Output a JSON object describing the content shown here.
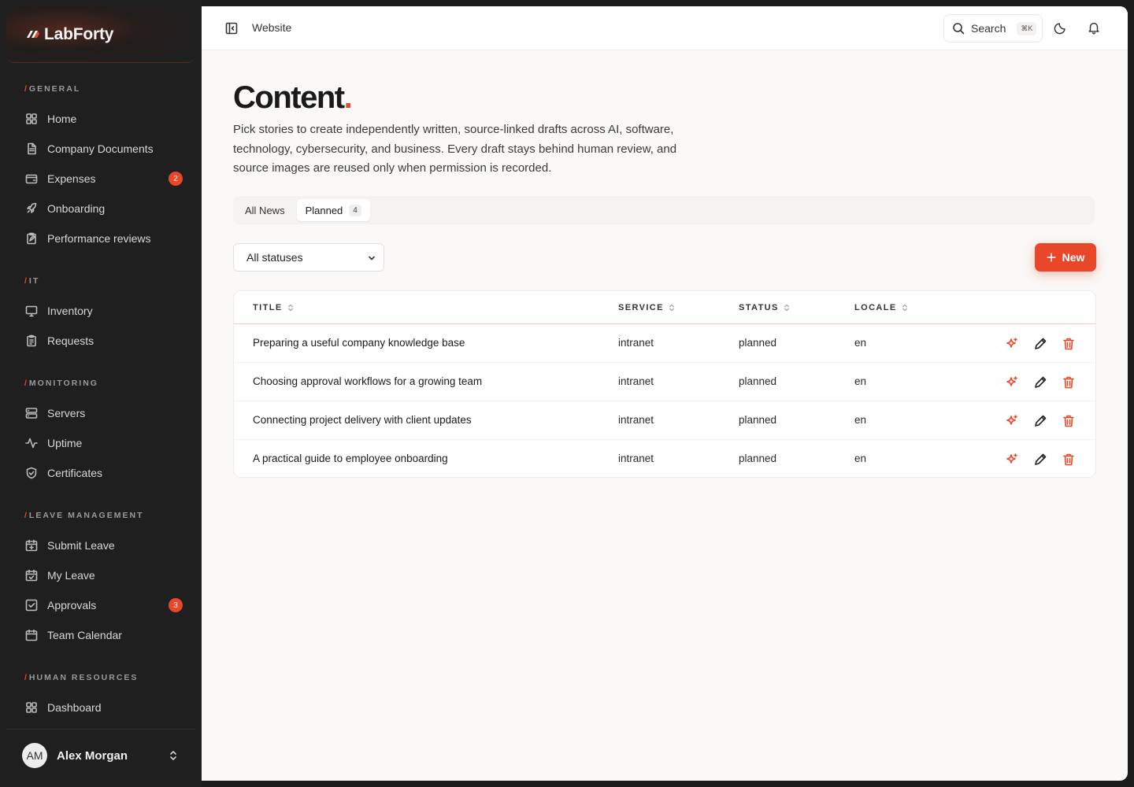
{
  "brand": {
    "name": "LabForty"
  },
  "sidebar": {
    "sections": [
      {
        "label": "GENERAL"
      },
      {
        "label": "IT"
      },
      {
        "label": "MONITORING"
      },
      {
        "label": "LEAVE MANAGEMENT"
      },
      {
        "label": "HUMAN RESOURCES"
      }
    ],
    "items": [
      {
        "label": "Home",
        "icon": "grid-icon"
      },
      {
        "label": "Company Documents",
        "icon": "document-icon"
      },
      {
        "label": "Expenses",
        "icon": "wallet-icon",
        "badge": "2"
      },
      {
        "label": "Onboarding",
        "icon": "rocket-icon"
      },
      {
        "label": "Performance reviews",
        "icon": "clipboard-edit-icon"
      },
      {
        "label": "Inventory",
        "icon": "monitor-icon"
      },
      {
        "label": "Requests",
        "icon": "clipboard-list-icon"
      },
      {
        "label": "Servers",
        "icon": "server-icon"
      },
      {
        "label": "Uptime",
        "icon": "activity-icon"
      },
      {
        "label": "Certificates",
        "icon": "shield-check-icon"
      },
      {
        "label": "Submit Leave",
        "icon": "calendar-plus-icon"
      },
      {
        "label": "My Leave",
        "icon": "calendar-check-icon"
      },
      {
        "label": "Approvals",
        "icon": "check-square-icon",
        "badge": "3"
      },
      {
        "label": "Team Calendar",
        "icon": "calendar-icon"
      },
      {
        "label": "Dashboard",
        "icon": "grid-icon"
      }
    ],
    "user": {
      "initials": "AM",
      "name": "Alex Morgan"
    }
  },
  "topbar": {
    "breadcrumb": "Website",
    "search_label": "Search",
    "search_shortcut": "⌘K"
  },
  "page": {
    "title": "Content",
    "title_dot": ".",
    "description": "Pick stories to create independently written, source-linked drafts across AI, software, technology, cybersecurity, and business. Every draft stays behind human review, and source images are reused only when permission is recorded."
  },
  "tabs": [
    {
      "label": "All News"
    },
    {
      "label": "Planned",
      "count": "4"
    }
  ],
  "filter": {
    "selected": "All statuses"
  },
  "new_button": {
    "label": "New"
  },
  "table": {
    "columns": [
      "TITLE",
      "SERVICE",
      "STATUS",
      "LOCALE"
    ],
    "rows": [
      {
        "title": "Preparing a useful company knowledge base",
        "service": "intranet",
        "status": "planned",
        "locale": "en"
      },
      {
        "title": "Choosing approval workflows for a growing team",
        "service": "intranet",
        "status": "planned",
        "locale": "en"
      },
      {
        "title": "Connecting project delivery with client updates",
        "service": "intranet",
        "status": "planned",
        "locale": "en"
      },
      {
        "title": "A practical guide to employee onboarding",
        "service": "intranet",
        "status": "planned",
        "locale": "en"
      }
    ]
  },
  "colors": {
    "accent": "#e8472a",
    "sidebar_bg": "#1f1f1f",
    "main_bg": "#faf9f8"
  }
}
